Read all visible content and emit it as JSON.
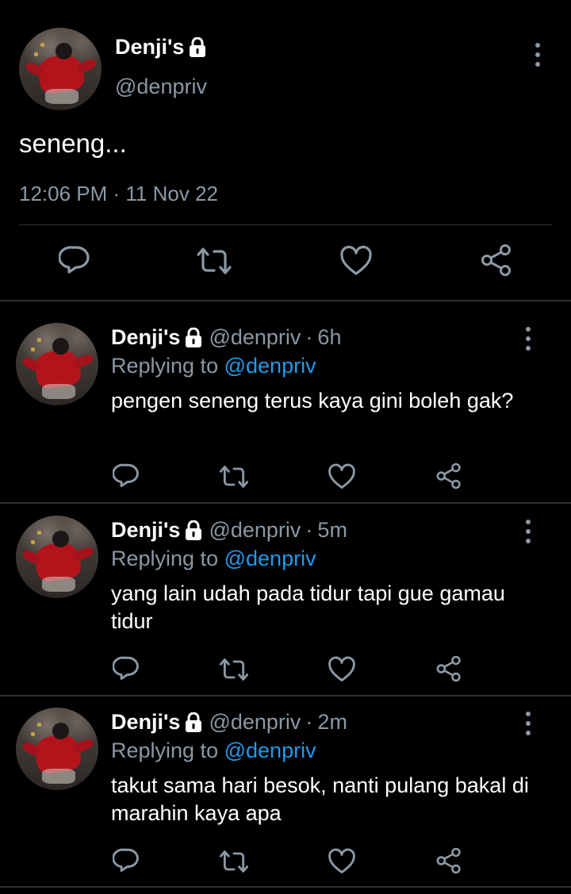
{
  "main_tweet": {
    "display_name": "Denji's",
    "handle": "@denpriv",
    "text": "seneng...",
    "meta": "12:06 PM · 11 Nov 22"
  },
  "replies": [
    {
      "display_name": "Denji's",
      "handle": "@denpriv",
      "separator": "·",
      "time": "6h",
      "replying_prefix": "Replying to",
      "replying_to": "@denpriv",
      "text": "pengen seneng terus kaya gini boleh gak?"
    },
    {
      "display_name": "Denji's",
      "handle": "@denpriv",
      "separator": "·",
      "time": "5m",
      "replying_prefix": "Replying to",
      "replying_to": "@denpriv",
      "text": "yang lain udah pada tidur tapi gue gamau tidur"
    },
    {
      "display_name": "Denji's",
      "handle": "@denpriv",
      "separator": "·",
      "time": "2m",
      "replying_prefix": "Replying to",
      "replying_to": "@denpriv",
      "text": "takut sama hari besok, nanti pulang bakal di marahin kaya apa"
    }
  ],
  "icons": {
    "reply": "reply-icon",
    "retweet": "retweet-icon",
    "like": "heart-icon",
    "share": "share-icon",
    "lock": "lock-icon",
    "more": "more-vertical-icon"
  },
  "colors": {
    "background": "#000000",
    "text_primary": "#ffffff",
    "text_secondary": "#8b98a5",
    "mention": "#1d9bf0",
    "divider": "#2f3336"
  }
}
